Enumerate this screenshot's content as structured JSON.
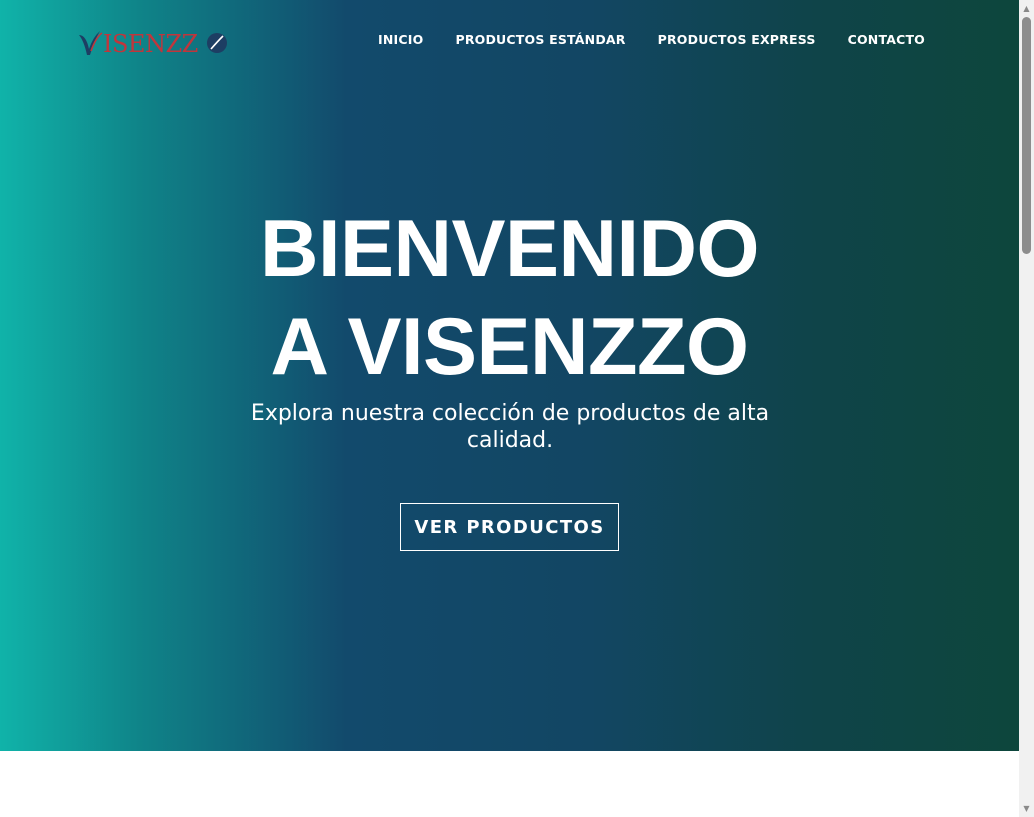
{
  "header": {
    "logo_text": "VISENZZO",
    "nav": [
      {
        "label": "INICIO"
      },
      {
        "label": "PRODUCTOS ESTÁNDAR"
      },
      {
        "label": "PRODUCTOS EXPRESS"
      },
      {
        "label": "CONTACTO"
      }
    ]
  },
  "hero": {
    "title_line1": "BIENVENIDO",
    "title_line2": "A VISENZZO",
    "subtitle": "Explora nuestra colección de productos de alta calidad.",
    "cta_label": "VER PRODUCTOS"
  },
  "colors": {
    "gradient_start": "#10b3a9",
    "gradient_mid": "#124a6c",
    "gradient_end": "#0d463c",
    "logo_red": "#c0363c",
    "logo_navy": "#1d3e63",
    "text": "#ffffff"
  },
  "scrollbar": {
    "up_icon": "triangle-up-icon",
    "down_icon": "triangle-down-icon"
  }
}
